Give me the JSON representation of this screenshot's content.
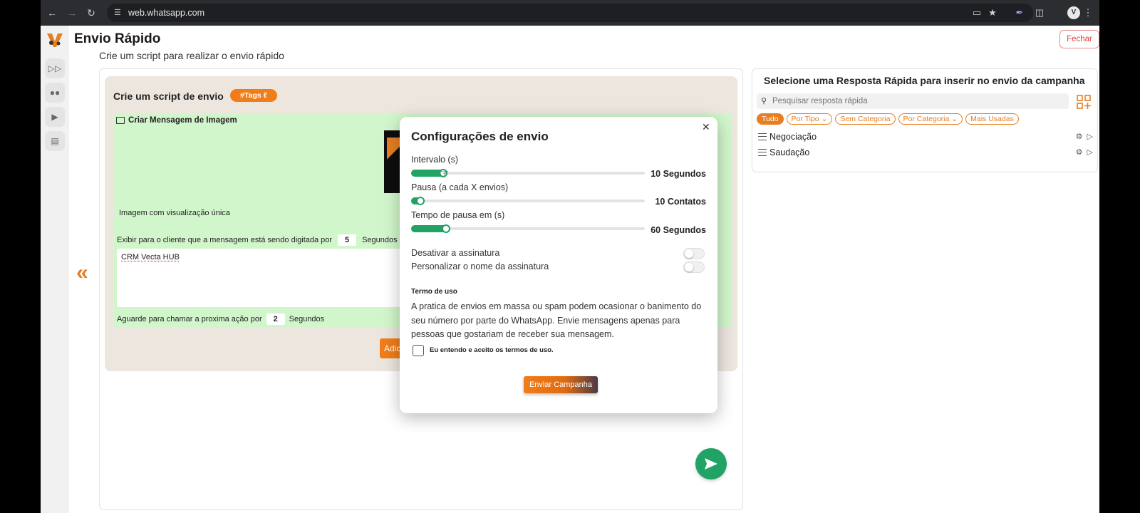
{
  "browser": {
    "url": "web.whatsapp.com"
  },
  "app": {
    "rail_items": [
      {
        "icon": "fast-forward-icon"
      },
      {
        "icon": "users-icon"
      },
      {
        "icon": "megaphone-icon"
      },
      {
        "icon": "clipboard-icon"
      }
    ]
  },
  "page": {
    "title": "Envio Rápido",
    "subtitle": "Crie um script para realizar o envio rápido",
    "close_label": "Fechar"
  },
  "script": {
    "title": "Crie um script de envio",
    "tags_label": "#Tags",
    "image_card": {
      "header": "Criar Mensagem de Imagem",
      "view_once_label": "Imagem com visualização única",
      "typing_prefix": "Exibir para o cliente que a mensagem está sendo digitada por",
      "typing_value": "5",
      "typing_suffix": "Segundos",
      "message_text": "CRM Vecta HUB",
      "wait_prefix": "Aguarde para chamar a proxima ação por",
      "wait_value": "2",
      "wait_suffix": "Segundos"
    },
    "add_button_label": "Adic"
  },
  "quick_replies": {
    "title": "Selecione uma Resposta Rápida para inserir no envio da campanha",
    "search_placeholder": "Pesquisar resposta rápida",
    "filters": [
      {
        "label": "Tudo",
        "active": true
      },
      {
        "label": "Por Tipo",
        "has_chevron": true
      },
      {
        "label": "Sem Categoria"
      },
      {
        "label": "Por Categoria",
        "has_chevron": true
      },
      {
        "label": "Mais Usadas"
      }
    ],
    "items": [
      {
        "label": "Negociação"
      },
      {
        "label": "Saudação"
      }
    ]
  },
  "modal": {
    "title": "Configurações de envio",
    "sliders": [
      {
        "label": "Intervalo (s)",
        "value_text": "10 Segundos",
        "fill_fraction": 0.12
      },
      {
        "label": "Pausa (a cada X envios)",
        "value_text": "10 Contatos",
        "fill_fraction": 0.02
      },
      {
        "label": "Tempo de pausa em (s)",
        "value_text": "60 Segundos",
        "fill_fraction": 0.13
      }
    ],
    "toggles": [
      {
        "label": "Desativar a assinatura",
        "on": false
      },
      {
        "label": "Personalizar o nome da assinatura",
        "on": false
      }
    ],
    "terms_heading": "Termo de uso",
    "terms_text": "A pratica de envios em massa ou spam podem ocasionar o banimento do seu número por parte do WhatsApp. Envie mensagens apenas para pessoas que gostariam de receber sua mensagem.",
    "terms_check_label": "Eu entendo e aceito os termos de uso.",
    "send_label": "Enviar Campanha"
  },
  "colors": {
    "accent_orange": "#e67e22",
    "accent_green": "#21a366",
    "card_green": "#d2f6cb",
    "card_beige": "#ece6df"
  }
}
